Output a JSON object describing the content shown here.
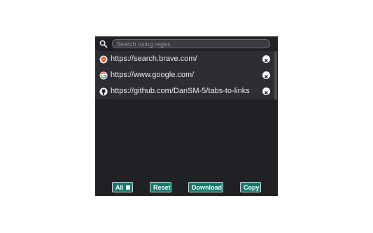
{
  "search": {
    "placeholder": "Search using regex",
    "value": ""
  },
  "tabs": [
    {
      "url": "https://search.brave.com/",
      "icon": "brave-icon"
    },
    {
      "url": "https://www.google.com/",
      "icon": "google-icon"
    },
    {
      "url": "https://github.com/DanSM-5/tabs-to-links",
      "icon": "github-icon"
    }
  ],
  "footer": {
    "all_label": "All",
    "reset_label": "Reset",
    "download_label": "Download",
    "copy_label": "Copy"
  },
  "colors": {
    "background": "#202124",
    "row": "#2d2e31",
    "button": "#0f7a6b",
    "text": "#e8eaed"
  }
}
